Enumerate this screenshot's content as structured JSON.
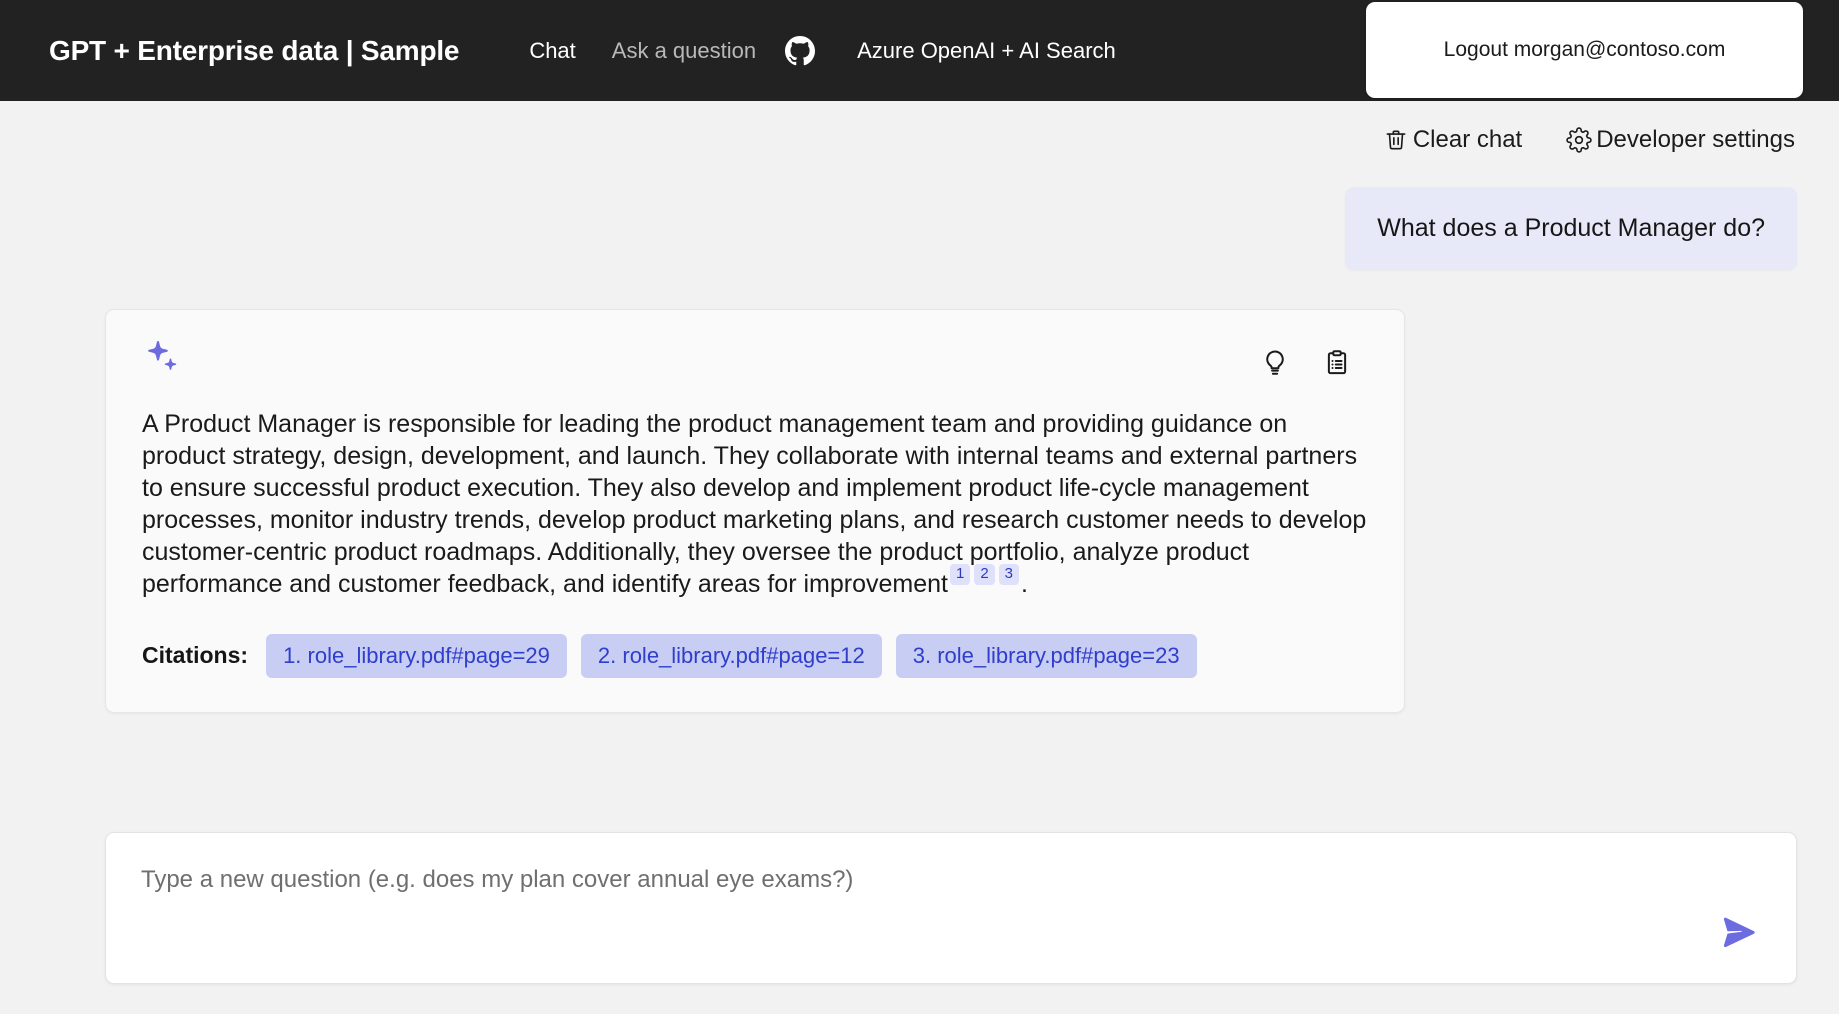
{
  "header": {
    "title": "GPT + Enterprise data | Sample",
    "nav": [
      {
        "label": "Chat",
        "active": true
      },
      {
        "label": "Ask a question",
        "active": false
      }
    ],
    "github_icon": "github-icon",
    "subtitle": "Azure OpenAI + AI Search",
    "logout_label": "Logout morgan@contoso.com",
    "background_color": "#222222"
  },
  "commands": {
    "clear_chat": "Clear chat",
    "clear_chat_icon": "trash-icon",
    "developer_settings": "Developer settings",
    "developer_settings_icon": "gear-icon"
  },
  "conversation": {
    "user_message": "What does a Product Manager do?",
    "answer": {
      "sparkle_icon": "sparkle-icon",
      "thought_process_icon": "lightbulb-icon",
      "supporting_content_icon": "clipboard-icon",
      "text_part_1": "A Product Manager is responsible for leading the product management team and providing guidance on product strategy, design, development, and launch. They collaborate with internal teams and external partners to ensure successful product execution. They also develop and implement product life-cycle management processes, monitor industry trends, develop product marketing plans, and research customer needs to develop customer-centric product roadmaps. Additionally, they oversee the product portfolio, analyze product performance and customer feedback, and identify areas for improvement",
      "superscript_1": "1",
      "superscript_2": "2",
      "superscript_3": "3",
      "text_part_2": ".",
      "citations_label": "Citations:",
      "citations": [
        "1. role_library.pdf#page=29",
        "2. role_library.pdf#page=12",
        "3. role_library.pdf#page=23"
      ]
    }
  },
  "question_input": {
    "placeholder": "Type a new question (e.g. does my plan cover annual eye exams?)",
    "value": "",
    "send_icon": "send-arrow-icon"
  },
  "colors": {
    "accent": "#6c6ce0",
    "user_bubble": "#e8e9f8",
    "citation_chip": "#c8cdf4",
    "citation_text": "#2f3ecb",
    "header_bg": "#222222",
    "page_bg": "#f2f2f2"
  }
}
